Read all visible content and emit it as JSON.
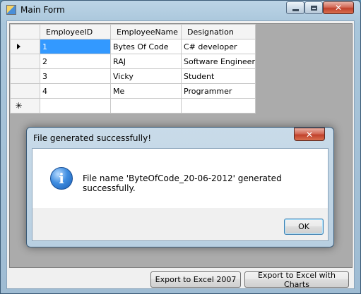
{
  "window": {
    "title": "Main Form"
  },
  "grid": {
    "columns": [
      "EmployeeID",
      "EmployeeName",
      "Designation"
    ],
    "rows": [
      [
        "1",
        "Bytes Of Code",
        "C# developer"
      ],
      [
        "2",
        "RAJ",
        "Software Engineer"
      ],
      [
        "3",
        "Vicky",
        "Student"
      ],
      [
        "4",
        "Me",
        "Programmer"
      ]
    ]
  },
  "buttons": {
    "export_2007": "Export to Excel 2007",
    "export_charts": "Export to Excel with Charts"
  },
  "dialog": {
    "title": "File generated successfully!",
    "message": "File name 'ByteOfCode_20-06-2012' generated successfully.",
    "ok_label": "OK"
  },
  "icons": {
    "app": "app-form-icon",
    "info": "information-icon",
    "current_row": "current-row-arrow-icon",
    "new_row": "new-row-asterisk-icon"
  }
}
